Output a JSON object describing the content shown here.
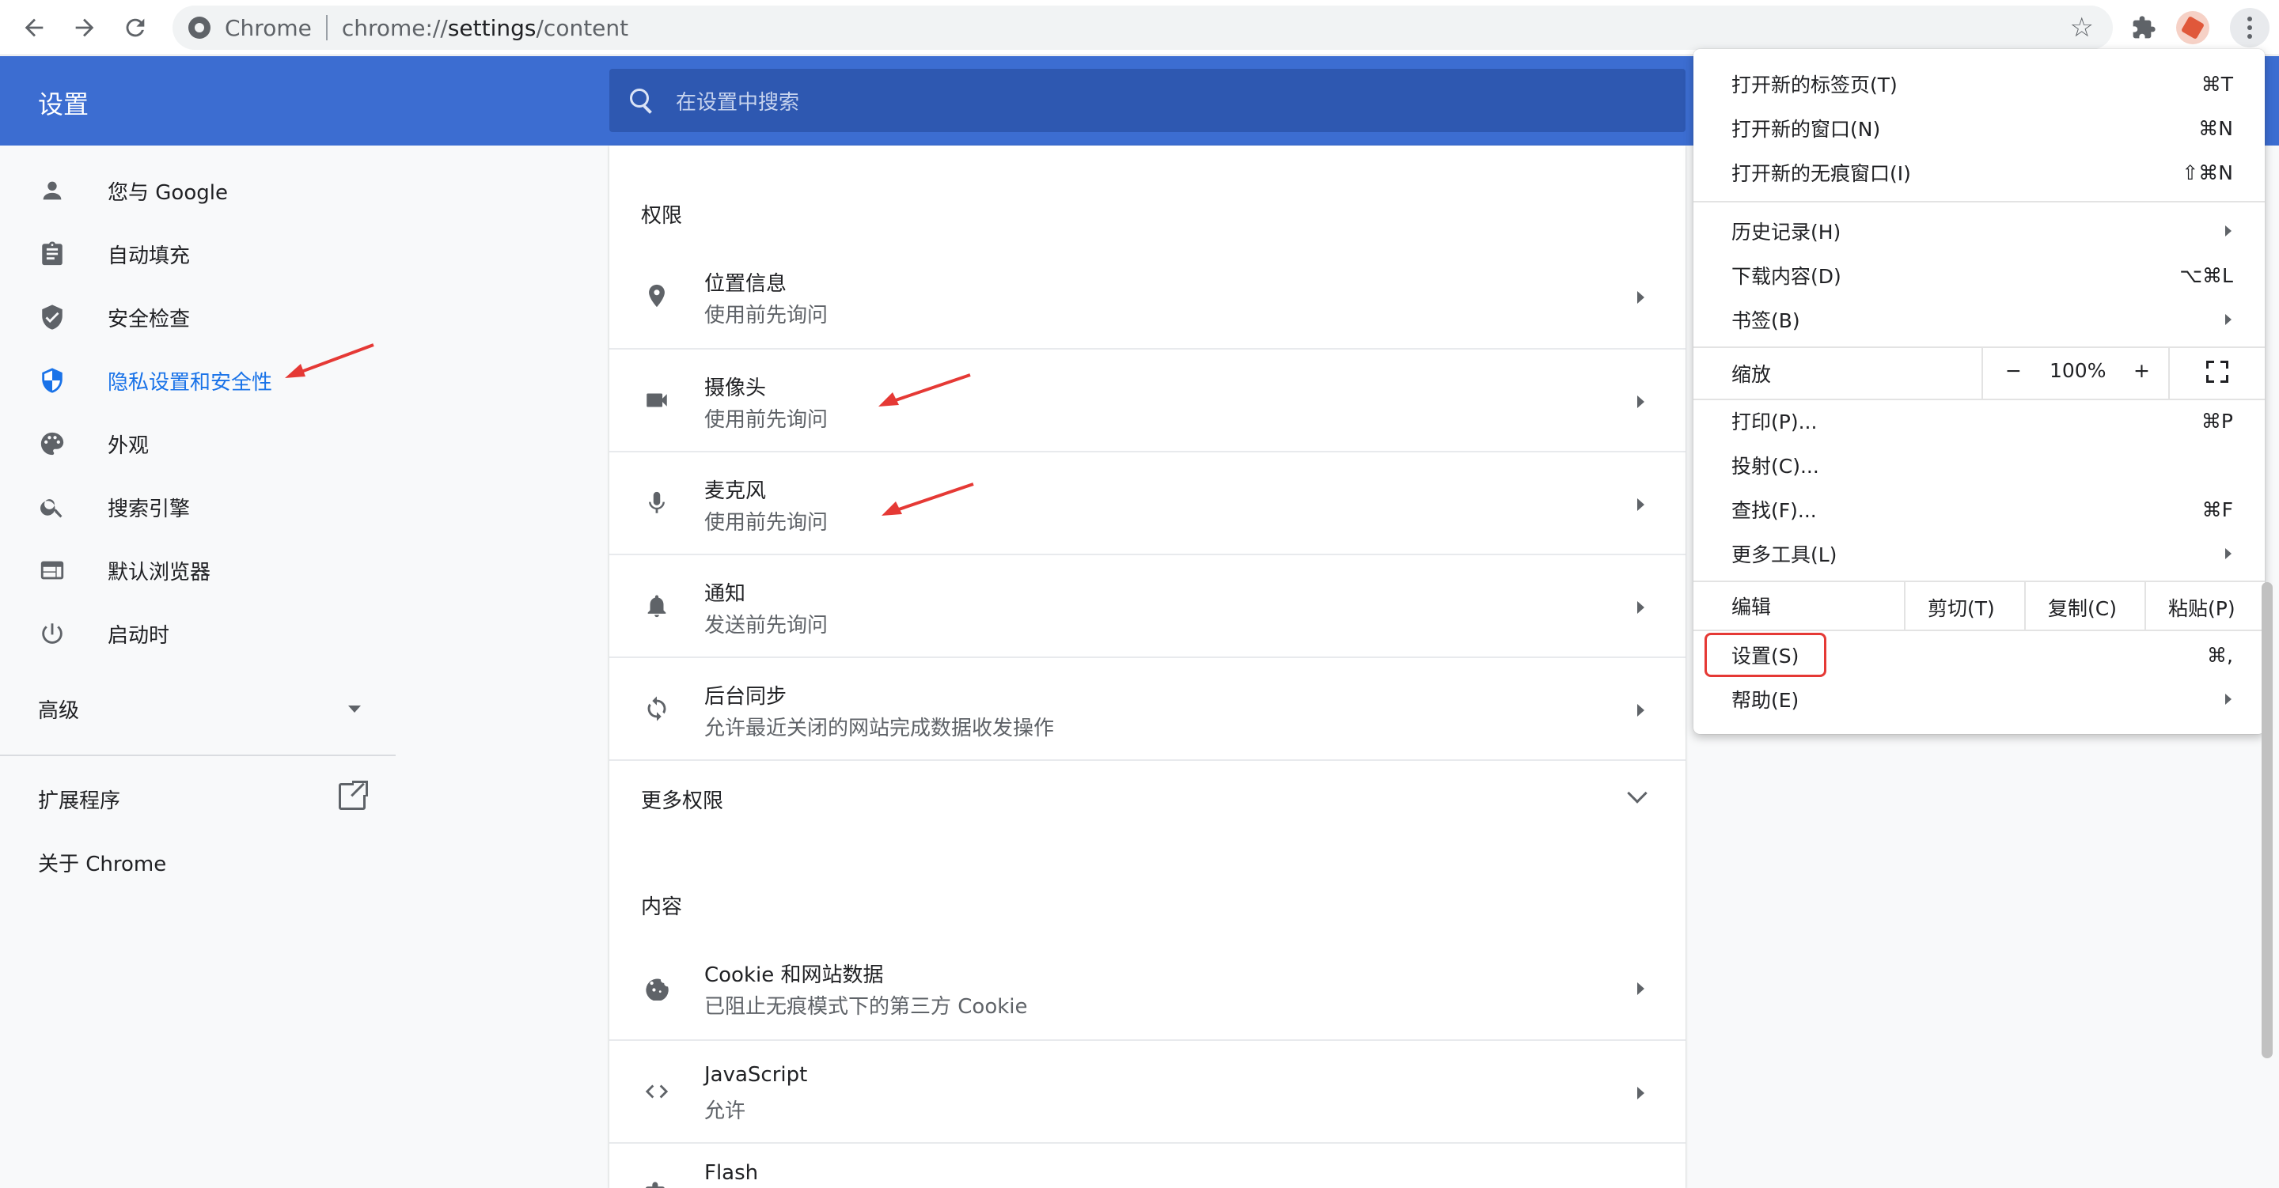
{
  "browser": {
    "chip": "Chrome",
    "url_prefix": "chrome://",
    "url_host": "settings",
    "url_path": "/content"
  },
  "header": {
    "title": "设置",
    "search_placeholder": "在设置中搜索"
  },
  "sidebar": {
    "items": [
      {
        "label": "您与 Google",
        "icon": "person-icon"
      },
      {
        "label": "自动填充",
        "icon": "clipboard-icon"
      },
      {
        "label": "安全检查",
        "icon": "shield-check-icon"
      },
      {
        "label": "隐私设置和安全性",
        "icon": "privacy-shield-icon"
      },
      {
        "label": "外观",
        "icon": "palette-icon"
      },
      {
        "label": "搜索引擎",
        "icon": "search-icon"
      },
      {
        "label": "默认浏览器",
        "icon": "browser-window-icon"
      },
      {
        "label": "启动时",
        "icon": "power-icon"
      }
    ],
    "advanced": "高级",
    "extensions": "扩展程序",
    "about": "关于 Chrome",
    "active_index": 3
  },
  "main": {
    "permissions_title": "权限",
    "rows": [
      {
        "title": "位置信息",
        "sub": "使用前先询问",
        "icon": "location-icon"
      },
      {
        "title": "摄像头",
        "sub": "使用前先询问",
        "icon": "camera-icon"
      },
      {
        "title": "麦克风",
        "sub": "使用前先询问",
        "icon": "microphone-icon"
      },
      {
        "title": "通知",
        "sub": "发送前先询问",
        "icon": "bell-icon"
      },
      {
        "title": "后台同步",
        "sub": "允许最近关闭的网站完成数据收发操作",
        "icon": "sync-icon"
      }
    ],
    "more_permissions": "更多权限",
    "content_title": "内容",
    "content_rows": [
      {
        "title": "Cookie 和网站数据",
        "sub": "已阻止无痕模式下的第三方 Cookie",
        "icon": "cookie-icon"
      },
      {
        "title": "JavaScript",
        "sub": "允许",
        "icon": "code-icon"
      },
      {
        "title": "Flash",
        "sub": "",
        "icon": "puzzle-icon"
      }
    ]
  },
  "menu": {
    "new_tab": {
      "label": "打开新的标签页(T)",
      "shortcut": "⌘T"
    },
    "new_window": {
      "label": "打开新的窗口(N)",
      "shortcut": "⌘N"
    },
    "new_incognito": {
      "label": "打开新的无痕窗口(I)",
      "shortcut": "⇧⌘N"
    },
    "history": {
      "label": "历史记录(H)"
    },
    "downloads": {
      "label": "下载内容(D)",
      "shortcut": "⌥⌘L"
    },
    "bookmarks": {
      "label": "书签(B)"
    },
    "zoom": {
      "label": "缩放",
      "minus": "−",
      "value": "100%",
      "plus": "+"
    },
    "print": {
      "label": "打印(P)...",
      "shortcut": "⌘P"
    },
    "cast": {
      "label": "投射(C)..."
    },
    "find": {
      "label": "查找(F)...",
      "shortcut": "⌘F"
    },
    "more_tools": {
      "label": "更多工具(L)"
    },
    "edit": {
      "label": "编辑",
      "cut": "剪切(T)",
      "copy": "复制(C)",
      "paste": "粘贴(P)"
    },
    "settings": {
      "label": "设置(S)",
      "shortcut": "⌘,"
    },
    "help": {
      "label": "帮助(E)"
    }
  },
  "colors": {
    "header_blue": "#3c6dd1",
    "search_blue": "#2e58b1",
    "accent": "#1a73e8",
    "annotation_red": "#e53935"
  }
}
